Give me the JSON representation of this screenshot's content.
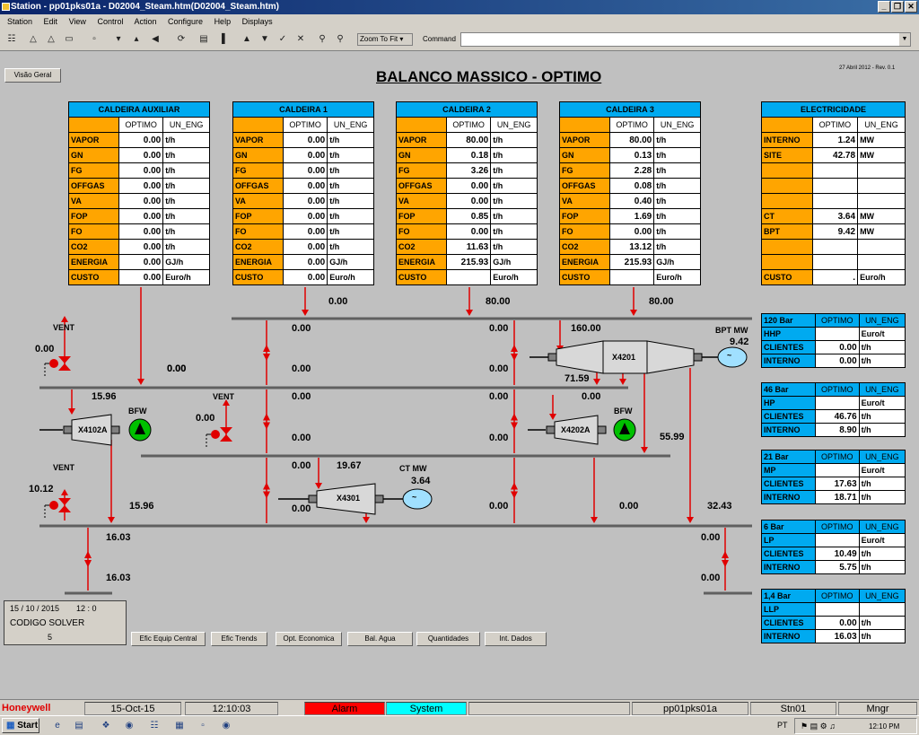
{
  "window": {
    "title": "Station - pp01pks01a - D02004_Steam.htm(D02004_Steam.htm)",
    "buttons": [
      "_",
      "❐",
      "✕"
    ]
  },
  "menu": [
    "Station",
    "Edit",
    "View",
    "Control",
    "Action",
    "Configure",
    "Help",
    "Displays"
  ],
  "toolbar": {
    "zoom_label": "Zoom To Fit",
    "command_label": "Command",
    "command_value": ""
  },
  "page": {
    "overview_button": "Visão Geral",
    "title": "BALANCO MASSICO - OPTIMO",
    "revision": "27 Abril 2012 - Rev. 0.1"
  },
  "boilers": [
    {
      "name": "CALDEIRA AUXILIAR",
      "col1": "OPTIMO",
      "col2": "UN_ENG",
      "rows": [
        {
          "label": "VAPOR",
          "value": "0.00",
          "unit": "t/h"
        },
        {
          "label": "GN",
          "value": "0.00",
          "unit": "t/h"
        },
        {
          "label": "FG",
          "value": "0.00",
          "unit": "t/h"
        },
        {
          "label": "OFFGAS",
          "value": "0.00",
          "unit": "t/h"
        },
        {
          "label": "VA",
          "value": "0.00",
          "unit": "t/h"
        },
        {
          "label": "FOP",
          "value": "0.00",
          "unit": "t/h"
        },
        {
          "label": "FO",
          "value": "0.00",
          "unit": "t/h"
        },
        {
          "label": "CO2",
          "value": "0.00",
          "unit": "t/h"
        },
        {
          "label": "ENERGIA",
          "value": "0.00",
          "unit": "GJ/h"
        },
        {
          "label": "CUSTO",
          "value": "0.00",
          "unit": "Euro/h"
        }
      ]
    },
    {
      "name": "CALDEIRA 1",
      "col1": "OPTIMO",
      "col2": "UN_ENG",
      "rows": [
        {
          "label": "VAPOR",
          "value": "0.00",
          "unit": "t/h"
        },
        {
          "label": "GN",
          "value": "0.00",
          "unit": "t/h"
        },
        {
          "label": "FG",
          "value": "0.00",
          "unit": "t/h"
        },
        {
          "label": "OFFGAS",
          "value": "0.00",
          "unit": "t/h"
        },
        {
          "label": "VA",
          "value": "0.00",
          "unit": "t/h"
        },
        {
          "label": "FOP",
          "value": "0.00",
          "unit": "t/h"
        },
        {
          "label": "FO",
          "value": "0.00",
          "unit": "t/h"
        },
        {
          "label": "CO2",
          "value": "0.00",
          "unit": "t/h"
        },
        {
          "label": "ENERGIA",
          "value": "0.00",
          "unit": "GJ/h"
        },
        {
          "label": "CUSTO",
          "value": "0.00",
          "unit": "Euro/h"
        }
      ]
    },
    {
      "name": "CALDEIRA 2",
      "col1": "OPTIMO",
      "col2": "UN_ENG",
      "rows": [
        {
          "label": "VAPOR",
          "value": "80.00",
          "unit": "t/h"
        },
        {
          "label": "GN",
          "value": "0.18",
          "unit": "t/h"
        },
        {
          "label": "FG",
          "value": "3.26",
          "unit": "t/h"
        },
        {
          "label": "OFFGAS",
          "value": "0.00",
          "unit": "t/h"
        },
        {
          "label": "VA",
          "value": "0.00",
          "unit": "t/h"
        },
        {
          "label": "FOP",
          "value": "0.85",
          "unit": "t/h"
        },
        {
          "label": "FO",
          "value": "0.00",
          "unit": "t/h"
        },
        {
          "label": "CO2",
          "value": "11.63",
          "unit": "t/h"
        },
        {
          "label": "ENERGIA",
          "value": "215.93",
          "unit": "GJ/h"
        },
        {
          "label": "CUSTO",
          "value": "",
          "unit": "Euro/h"
        }
      ]
    },
    {
      "name": "CALDEIRA 3",
      "col1": "OPTIMO",
      "col2": "UN_ENG",
      "rows": [
        {
          "label": "VAPOR",
          "value": "80.00",
          "unit": "t/h"
        },
        {
          "label": "GN",
          "value": "0.13",
          "unit": "t/h"
        },
        {
          "label": "FG",
          "value": "2.28",
          "unit": "t/h"
        },
        {
          "label": "OFFGAS",
          "value": "0.08",
          "unit": "t/h"
        },
        {
          "label": "VA",
          "value": "0.40",
          "unit": "t/h"
        },
        {
          "label": "FOP",
          "value": "1.69",
          "unit": "t/h"
        },
        {
          "label": "FO",
          "value": "0.00",
          "unit": "t/h"
        },
        {
          "label": "CO2",
          "value": "13.12",
          "unit": "t/h"
        },
        {
          "label": "ENERGIA",
          "value": "215.93",
          "unit": "GJ/h"
        },
        {
          "label": "CUSTO",
          "value": "",
          "unit": "Euro/h"
        }
      ]
    }
  ],
  "electricity": {
    "name": "ELECTRICIDADE",
    "col1": "OPTIMO",
    "col2": "UN_ENG",
    "rows": [
      {
        "label": "INTERNO",
        "value": "1.24",
        "unit": "MW"
      },
      {
        "label": "SITE",
        "value": "42.78",
        "unit": "MW"
      },
      {
        "label": "",
        "value": "",
        "unit": ""
      },
      {
        "label": "",
        "value": "",
        "unit": ""
      },
      {
        "label": "",
        "value": "",
        "unit": ""
      },
      {
        "label": "CT",
        "value": "3.64",
        "unit": "MW"
      },
      {
        "label": "BPT",
        "value": "9.42",
        "unit": "MW"
      },
      {
        "label": "",
        "value": "",
        "unit": ""
      },
      {
        "label": "",
        "value": "",
        "unit": ""
      },
      {
        "label": "CUSTO",
        "value": ".",
        "unit": "Euro/h"
      }
    ]
  },
  "headers": [
    {
      "name": "120 Bar",
      "col1": "OPTIMO",
      "col2": "UN_ENG",
      "rows": [
        {
          "label": "HHP",
          "value": "",
          "unit": "Euro/t"
        },
        {
          "label": "CLIENTES",
          "value": "0.00",
          "unit": "t/h"
        },
        {
          "label": "INTERNO",
          "value": "0.00",
          "unit": "t/h"
        }
      ]
    },
    {
      "name": "46 Bar",
      "col1": "OPTIMO",
      "col2": "UN_ENG",
      "rows": [
        {
          "label": "HP",
          "value": "",
          "unit": "Euro/t"
        },
        {
          "label": "CLIENTES",
          "value": "46.76",
          "unit": "t/h"
        },
        {
          "label": "INTERNO",
          "value": "8.90",
          "unit": "t/h"
        }
      ]
    },
    {
      "name": "21 Bar",
      "col1": "OPTIMO",
      "col2": "UN_ENG",
      "rows": [
        {
          "label": "MP",
          "value": "",
          "unit": "Euro/t"
        },
        {
          "label": "CLIENTES",
          "value": "17.63",
          "unit": "t/h"
        },
        {
          "label": "INTERNO",
          "value": "18.71",
          "unit": "t/h"
        }
      ]
    },
    {
      "name": "6 Bar",
      "col1": "OPTIMO",
      "col2": "UN_ENG",
      "rows": [
        {
          "label": "LP",
          "value": "",
          "unit": "Euro/t"
        },
        {
          "label": "CLIENTES",
          "value": "10.49",
          "unit": "t/h"
        },
        {
          "label": "INTERNO",
          "value": "5.75",
          "unit": "t/h"
        }
      ]
    },
    {
      "name": "1,4 Bar",
      "col1": "OPTIMO",
      "col2": "UN_ENG",
      "rows": [
        {
          "label": "LLP",
          "value": "",
          "unit": ""
        },
        {
          "label": "CLIENTES",
          "value": "0.00",
          "unit": "t/h"
        },
        {
          "label": "INTERNO",
          "value": "16.03",
          "unit": "t/h"
        }
      ]
    }
  ],
  "process": {
    "labels": {
      "vent1": "VENT",
      "vent2": "VENT",
      "vent3": "VENT",
      "bfw1": "BFW",
      "bfw2": "BFW",
      "x4102a": "X4102A",
      "x4301": "X4301",
      "x4201": "X4201",
      "x4202a": "X4202A",
      "ctmw": "CT MW",
      "bptmw": "BPT MW",
      "tilde1": "~",
      "tilde2": "~"
    },
    "values": {
      "aux_to_hdr": "0.00",
      "top_c1": "0.00",
      "top_c2": "80.00",
      "top_c3": "80.00",
      "c1_a": "0.00",
      "c2_a": "0.00",
      "t4201_in": "160.00",
      "bpt_mw": "9.42",
      "vent1_val": "0.00",
      "c0_b": "0.00",
      "c1_b": "0.00",
      "c2_b": "0.00",
      "t4201_out": "71.59",
      "t4201_out2": "0.00",
      "x4102a_flow": "15.96",
      "vent2_val": "0.00",
      "c1_c": "0.00",
      "c2_c": "0.00",
      "c1_d": "0.00",
      "c2_d": "0.00",
      "p55": "55.99",
      "x4301_in": "0.00",
      "x4301_val": "19.67",
      "ct_mw": "3.64",
      "x4301_out": "0.00",
      "c2_e": "0.00",
      "c3_e": "0.00",
      "r_3243": "32.43",
      "vent3_val": "10.12",
      "flow_1596": "15.96",
      "lp_1603": "16.03",
      "llp_1603": "16.03",
      "r_a": "0.00",
      "r_b": "0.00"
    }
  },
  "buttons": [
    "Efic Equip Central",
    "Efic Trends",
    "Opt. Economica",
    "Bal. Agua",
    "Quantidades",
    "Int. Dados"
  ],
  "solver": {
    "date": "15 / 10 / 2015",
    "time": "12 : 0",
    "label": "CODIGO SOLVER",
    "code": "5"
  },
  "statusbar": {
    "brand": "Honeywell",
    "date": "15-Oct-15",
    "time": "12:10:03",
    "alarm": "Alarm",
    "system": "System",
    "server": "pp01pks01a",
    "station": "Stn01",
    "user": "Mngr"
  },
  "taskbar": {
    "start": "Start",
    "lang": "PT",
    "clock": "12:10 PM"
  },
  "colors": {
    "alarm": "#ff0000",
    "system": "#00ffff",
    "table_header": "#00aaf0",
    "label_orange": "#ffa500",
    "pipe_red": "#e00000",
    "header_gray": "#606060"
  }
}
